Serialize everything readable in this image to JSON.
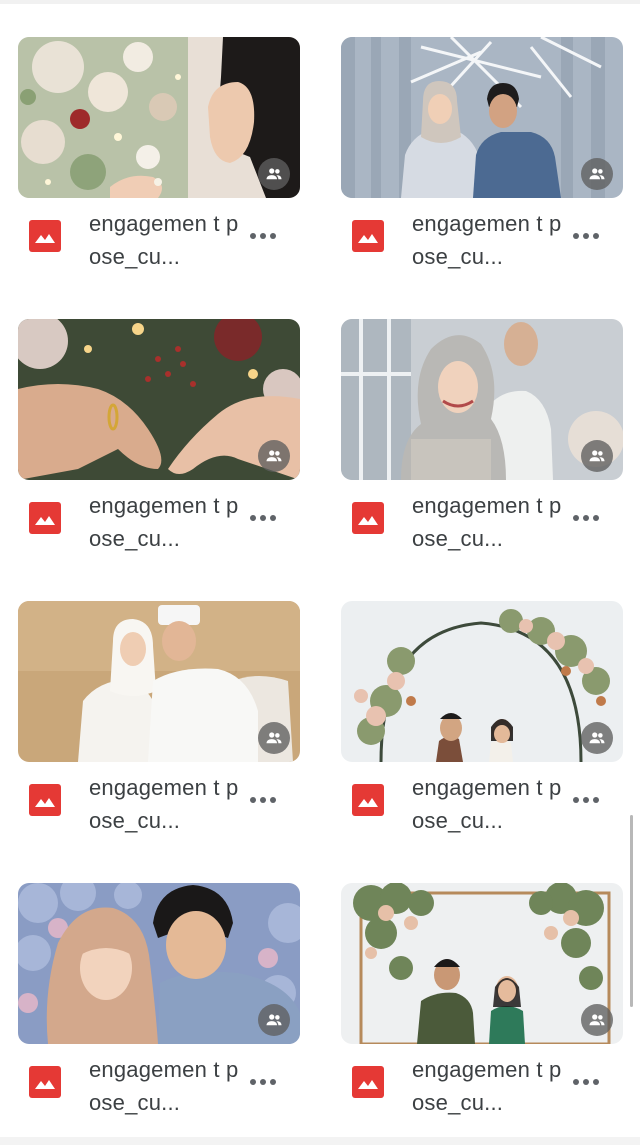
{
  "files": [
    {
      "name": "engagemen t pose_cu...",
      "type": "image",
      "shared": true,
      "thumbnail": "close-up of couple exchanging ring among flowers"
    },
    {
      "name": "engagemen t pose_cu...",
      "type": "image",
      "shared": true,
      "thumbnail": "couple in hijab and batik shirt standing before white backdrop"
    },
    {
      "name": "engagemen t pose_cu...",
      "type": "image",
      "shared": true,
      "thumbnail": "hands with gold ring forming heart shape"
    },
    {
      "name": "engagemen t pose_cu...",
      "type": "image",
      "shared": true,
      "thumbnail": "smiling woman in grey hijab with man behind"
    },
    {
      "name": "engagemen t pose_cu...",
      "type": "image",
      "shared": true,
      "thumbnail": "couple in white traditional attire on sofa"
    },
    {
      "name": "engagemen t pose_cu...",
      "type": "image",
      "shared": true,
      "thumbnail": "couple under floral arch"
    },
    {
      "name": "engagemen t pose_cu...",
      "type": "image",
      "shared": true,
      "thumbnail": "woman in peach hijab with man in blue shirt"
    },
    {
      "name": "engagemen t pose_cu...",
      "type": "image",
      "shared": true,
      "thumbnail": "couple in batik under floral frame"
    }
  ],
  "icons": {
    "file_type": "image-file-icon",
    "shared": "shared-people-icon",
    "more": "more-options-icon"
  },
  "colors": {
    "image_icon": "#e53935",
    "text": "#3c4043",
    "overlay": "#5f5f5f"
  }
}
